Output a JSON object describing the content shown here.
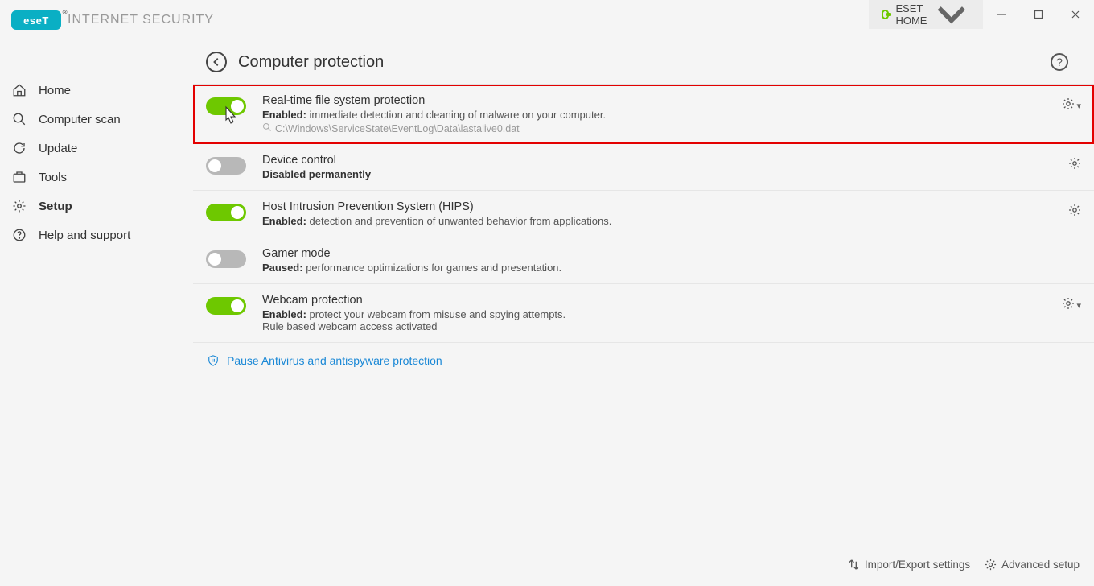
{
  "header": {
    "brand_text": "eseT",
    "product_name": "INTERNET SECURITY",
    "eset_home_label": "ESET HOME"
  },
  "sidebar": {
    "items": [
      {
        "label": "Home"
      },
      {
        "label": "Computer scan"
      },
      {
        "label": "Update"
      },
      {
        "label": "Tools"
      },
      {
        "label": "Setup"
      },
      {
        "label": "Help and support"
      }
    ]
  },
  "main": {
    "title": "Computer protection",
    "rows": [
      {
        "title": "Real-time file system protection",
        "status_label": "Enabled:",
        "status_text": "immediate detection and cleaning of malware on your computer.",
        "detail": "C:\\Windows\\ServiceState\\EventLog\\Data\\lastalive0.dat",
        "toggle": "on",
        "has_chev": true,
        "highlighted": true,
        "has_detail": true
      },
      {
        "title": "Device control",
        "status_label": "Disabled permanently",
        "status_text": "",
        "toggle": "off",
        "has_chev": false
      },
      {
        "title": "Host Intrusion Prevention System (HIPS)",
        "status_label": "Enabled:",
        "status_text": "detection and prevention of unwanted behavior from applications.",
        "toggle": "on",
        "has_chev": false
      },
      {
        "title": "Gamer mode",
        "status_label": "Paused:",
        "status_text": "performance optimizations for games and presentation.",
        "toggle": "off",
        "no_gear": true
      },
      {
        "title": "Webcam protection",
        "status_label": "Enabled:",
        "status_text": "protect your webcam from misuse and spying attempts.",
        "extra_line": "Rule based webcam access activated",
        "toggle": "on",
        "has_chev": true
      }
    ],
    "pause_link": "Pause Antivirus and antispyware protection"
  },
  "footer": {
    "import_export": "Import/Export settings",
    "advanced": "Advanced setup"
  }
}
